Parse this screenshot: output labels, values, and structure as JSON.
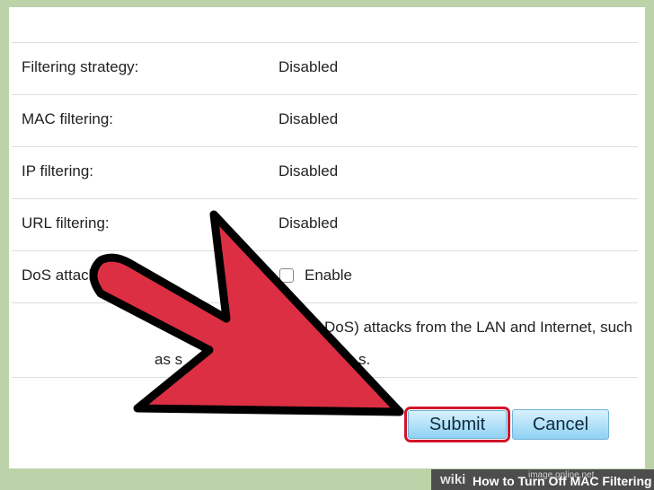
{
  "settings": {
    "rows": [
      {
        "label": "Filtering strategy:",
        "value": "Disabled"
      },
      {
        "label": "MAC filtering:",
        "value": "Disabled"
      },
      {
        "label": "IP filtering:",
        "value": "Disabled"
      },
      {
        "label": "URL filtering:",
        "value": "Disabled"
      }
    ],
    "dos": {
      "label": "DoS attack",
      "option_label": "Enable",
      "checked": false,
      "description_line1": "DoS) attacks from the LAN and Internet, such",
      "description_line2_start": "as s",
      "description_line2_end": "s."
    }
  },
  "buttons": {
    "submit_label": "Submit",
    "cancel_label": "Cancel"
  },
  "footer": {
    "wiki_text": "wiki",
    "title": "How to Turn Off MAC Filtering",
    "watermark": "image.online.net"
  },
  "colors": {
    "frame": "#bcd3a9",
    "arrow_fill": "#dc2f43",
    "submit_highlight": "#d2142a",
    "button_gradient_top": "#d9f1fd",
    "button_gradient_bottom": "#8ed2f3"
  },
  "icons": {
    "pointer": "red-arrow-icon",
    "checkbox": "checkbox-icon"
  }
}
